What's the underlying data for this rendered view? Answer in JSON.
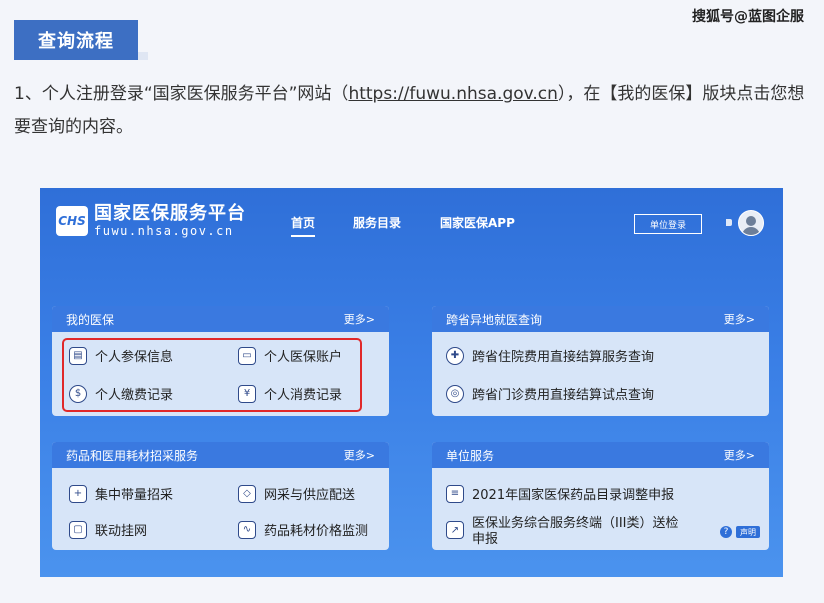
{
  "article": {
    "section_tab": "查询流程",
    "watermark": "搜狐号@蓝图企服",
    "para_before_url": "1、个人注册登录“国家医保服务平台”网站（",
    "para_url": "https://fuwu.nhsa.gov.cn",
    "para_after_url": "），在【我的医保】版块点击您想要查询的内容。"
  },
  "site": {
    "logo_box": "CHS",
    "title": "国家医保服务平台",
    "url": "fuwu.nhsa.gov.cn",
    "nav": [
      "首页",
      "服务目录",
      "国家医保APP"
    ],
    "unit_login": "单位登录"
  },
  "cards": {
    "my_insurance": {
      "title": "我的医保",
      "more": "更多>",
      "items": [
        "个人参保信息",
        "个人医保账户",
        "个人缴费记录",
        "个人消费记录"
      ]
    },
    "cross_province": {
      "title": "跨省异地就医查询",
      "more": "更多>",
      "items": [
        "跨省住院费用直接结算服务查询",
        "跨省门诊费用直接结算试点查询"
      ]
    },
    "drugs": {
      "title": "药品和医用耗材招采服务",
      "more": "更多>",
      "items": [
        "集中带量招采",
        "网采与供应配送",
        "联动挂网",
        "药品耗材价格监测"
      ]
    },
    "unit_service": {
      "title": "单位服务",
      "more": "更多>",
      "items": [
        "2021年国家医保药品目录调整申报",
        "医保业务综合服务终端（III类）送检",
        "申报"
      ],
      "help": "?",
      "notice": "声明"
    }
  },
  "icons": {
    "profile": "id-card-icon",
    "wallet": "wallet-icon",
    "payment": "payment-icon",
    "yuan": "yuan-icon",
    "hospital": "hospital-icon",
    "clinic": "clinic-icon",
    "procurement": "procurement-icon",
    "delivery": "delivery-icon",
    "network": "network-icon",
    "monitor": "monitor-icon",
    "catalog": "catalog-icon",
    "terminal": "terminal-icon"
  },
  "colors": {
    "tab": "#3d6fc3",
    "header_blue": "#2f6fd8",
    "card_head": "#3a79e0",
    "card_body": "#d7e5f8",
    "highlight_red": "#e0282a"
  }
}
